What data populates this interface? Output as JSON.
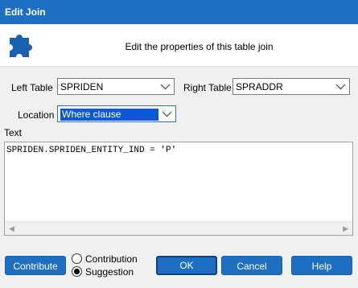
{
  "window": {
    "title": "Edit Join"
  },
  "banner": {
    "description": "Edit the properties of this table join",
    "icon": "puzzle-icon"
  },
  "form": {
    "left_table_label": "Left Table",
    "left_table_value": "SPRIDEN",
    "right_table_label": "Right Table",
    "right_table_value": "SPRADDR",
    "location_label": "Location",
    "location_value": "Where clause",
    "text_label": "Text",
    "text_value": "SPRIDEN.SPRIDEN_ENTITY_IND = 'P'"
  },
  "footer": {
    "contribute_label": "Contribute",
    "contribution_label": "Contribution",
    "suggestion_label": "Suggestion",
    "selected_option": "Suggestion",
    "ok_label": "OK",
    "cancel_label": "Cancel",
    "help_label": "Help"
  },
  "colors": {
    "accent": "#1e6fc2",
    "selection": "#0a58d8",
    "icon": "#1a5fb0"
  }
}
